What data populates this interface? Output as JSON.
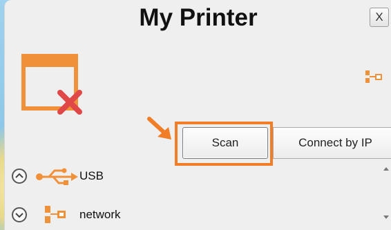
{
  "window": {
    "title": "My Printer",
    "close_label": "X"
  },
  "buttons": {
    "scan": "Scan",
    "connect_by_ip": "Connect by IP"
  },
  "connection_list": [
    {
      "label": "USB",
      "icon": "usb-icon",
      "expanded": true
    },
    {
      "label": "network",
      "icon": "network-icon",
      "expanded": false
    }
  ],
  "colors": {
    "accent": "#f17d27",
    "error": "#e04848",
    "printer_outline": "#f0913a"
  }
}
